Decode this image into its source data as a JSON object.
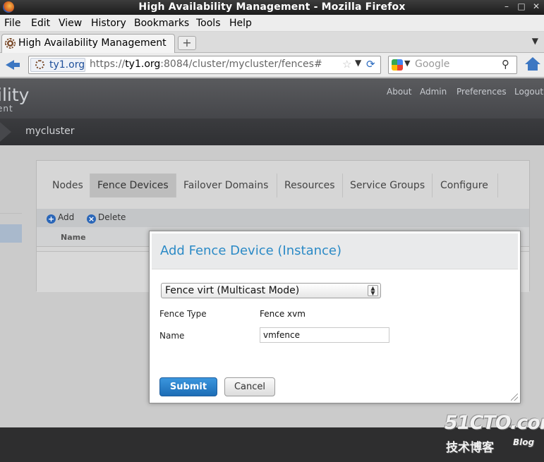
{
  "window": {
    "title": "High Availability Management - Mozilla Firefox",
    "controls": [
      "–",
      "□",
      "✕"
    ]
  },
  "menu": [
    "File",
    "Edit",
    "View",
    "History",
    "Bookmarks",
    "Tools",
    "Help"
  ],
  "browser_tab": {
    "label": "High Availability Management",
    "new_tab": "+"
  },
  "nav": {
    "site_identity": "ty1.org",
    "url_prefix": "https://",
    "url_host": "ty1.org",
    "url_rest": ":8084/cluster/mycluster/fences#",
    "search_placeholder": "Google"
  },
  "app": {
    "logo_line1": "ility",
    "logo_line2": "ent",
    "top_links": [
      "About",
      "Admin",
      "Preferences",
      "Logout"
    ],
    "breadcrumb": "mycluster",
    "tabs": [
      "Nodes",
      "Fence Devices",
      "Failover Domains",
      "Resources",
      "Service Groups",
      "Configure"
    ],
    "active_tab": "Fence Devices",
    "toolbar": {
      "add": "Add",
      "delete": "Delete"
    },
    "column_name": "Name"
  },
  "dialog": {
    "title": "Add Fence Device (Instance)",
    "device_select": "Fence virt (Multicast Mode)",
    "fence_type_label": "Fence Type",
    "fence_type_value": "Fence xvm",
    "name_label": "Name",
    "name_value": "vmfence",
    "submit": "Submit",
    "cancel": "Cancel"
  },
  "watermark": {
    "line1": "51CTO.com",
    "line2": "技术博客",
    "line3": "Blog"
  }
}
